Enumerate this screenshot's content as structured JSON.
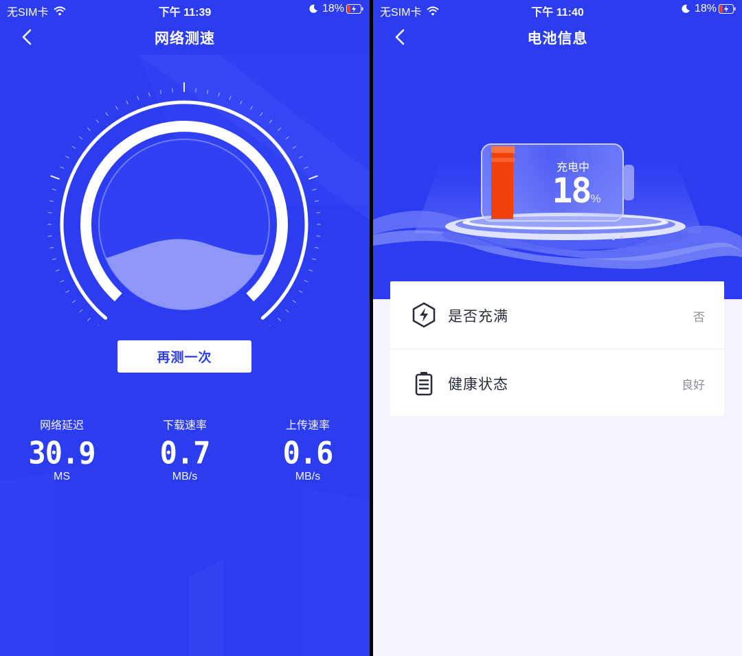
{
  "left_screen": {
    "status_bar": {
      "carrier": "无SIM卡",
      "time": "下午 11:39",
      "battery": "18%"
    },
    "nav": {
      "title": "网络测速",
      "back_icon": "chevron-left-icon"
    },
    "retest_button": "再测一次",
    "stats": [
      {
        "label": "网络延迟",
        "value": "30.9",
        "unit": "MS"
      },
      {
        "label": "下载速率",
        "value": "0.7",
        "unit": "MB/s"
      },
      {
        "label": "上传速率",
        "value": "0.6",
        "unit": "MB/s"
      }
    ],
    "colors": {
      "background": "#2b3cf1",
      "accent": "#ffffff"
    }
  },
  "right_screen": {
    "status_bar": {
      "carrier": "无SIM卡",
      "time": "下午 11:40",
      "battery": "18%"
    },
    "nav": {
      "title": "电池信息",
      "back_icon": "chevron-left-icon"
    },
    "battery": {
      "state": "充电中",
      "percent": "18",
      "percent_sign": "%",
      "level": 0.18
    },
    "info_items": [
      {
        "name": "是否充满",
        "value": "否",
        "icon": "lightning-hexagon-icon"
      },
      {
        "name": "健康状态",
        "value": "良好",
        "icon": "battery-icon"
      }
    ],
    "colors": {
      "header": "#2b3cf1",
      "battery_fill": "#f2410a",
      "page": "#f3f4fb"
    }
  }
}
